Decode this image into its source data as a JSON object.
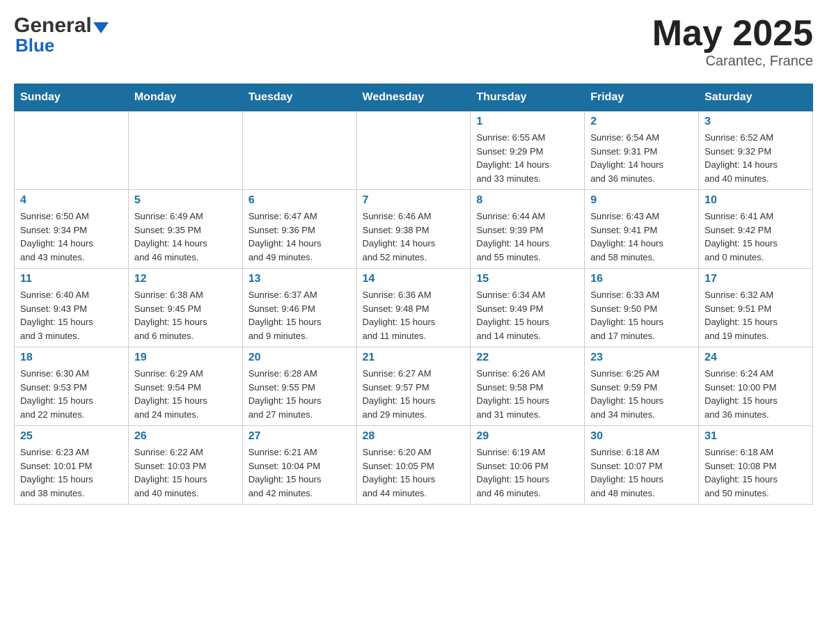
{
  "header": {
    "logo_line1": "General",
    "logo_line2": "Blue",
    "month_year": "May 2025",
    "location": "Carantec, France"
  },
  "days_of_week": [
    "Sunday",
    "Monday",
    "Tuesday",
    "Wednesday",
    "Thursday",
    "Friday",
    "Saturday"
  ],
  "weeks": [
    [
      {
        "day": "",
        "info": ""
      },
      {
        "day": "",
        "info": ""
      },
      {
        "day": "",
        "info": ""
      },
      {
        "day": "",
        "info": ""
      },
      {
        "day": "1",
        "info": "Sunrise: 6:55 AM\nSunset: 9:29 PM\nDaylight: 14 hours\nand 33 minutes."
      },
      {
        "day": "2",
        "info": "Sunrise: 6:54 AM\nSunset: 9:31 PM\nDaylight: 14 hours\nand 36 minutes."
      },
      {
        "day": "3",
        "info": "Sunrise: 6:52 AM\nSunset: 9:32 PM\nDaylight: 14 hours\nand 40 minutes."
      }
    ],
    [
      {
        "day": "4",
        "info": "Sunrise: 6:50 AM\nSunset: 9:34 PM\nDaylight: 14 hours\nand 43 minutes."
      },
      {
        "day": "5",
        "info": "Sunrise: 6:49 AM\nSunset: 9:35 PM\nDaylight: 14 hours\nand 46 minutes."
      },
      {
        "day": "6",
        "info": "Sunrise: 6:47 AM\nSunset: 9:36 PM\nDaylight: 14 hours\nand 49 minutes."
      },
      {
        "day": "7",
        "info": "Sunrise: 6:46 AM\nSunset: 9:38 PM\nDaylight: 14 hours\nand 52 minutes."
      },
      {
        "day": "8",
        "info": "Sunrise: 6:44 AM\nSunset: 9:39 PM\nDaylight: 14 hours\nand 55 minutes."
      },
      {
        "day": "9",
        "info": "Sunrise: 6:43 AM\nSunset: 9:41 PM\nDaylight: 14 hours\nand 58 minutes."
      },
      {
        "day": "10",
        "info": "Sunrise: 6:41 AM\nSunset: 9:42 PM\nDaylight: 15 hours\nand 0 minutes."
      }
    ],
    [
      {
        "day": "11",
        "info": "Sunrise: 6:40 AM\nSunset: 9:43 PM\nDaylight: 15 hours\nand 3 minutes."
      },
      {
        "day": "12",
        "info": "Sunrise: 6:38 AM\nSunset: 9:45 PM\nDaylight: 15 hours\nand 6 minutes."
      },
      {
        "day": "13",
        "info": "Sunrise: 6:37 AM\nSunset: 9:46 PM\nDaylight: 15 hours\nand 9 minutes."
      },
      {
        "day": "14",
        "info": "Sunrise: 6:36 AM\nSunset: 9:48 PM\nDaylight: 15 hours\nand 11 minutes."
      },
      {
        "day": "15",
        "info": "Sunrise: 6:34 AM\nSunset: 9:49 PM\nDaylight: 15 hours\nand 14 minutes."
      },
      {
        "day": "16",
        "info": "Sunrise: 6:33 AM\nSunset: 9:50 PM\nDaylight: 15 hours\nand 17 minutes."
      },
      {
        "day": "17",
        "info": "Sunrise: 6:32 AM\nSunset: 9:51 PM\nDaylight: 15 hours\nand 19 minutes."
      }
    ],
    [
      {
        "day": "18",
        "info": "Sunrise: 6:30 AM\nSunset: 9:53 PM\nDaylight: 15 hours\nand 22 minutes."
      },
      {
        "day": "19",
        "info": "Sunrise: 6:29 AM\nSunset: 9:54 PM\nDaylight: 15 hours\nand 24 minutes."
      },
      {
        "day": "20",
        "info": "Sunrise: 6:28 AM\nSunset: 9:55 PM\nDaylight: 15 hours\nand 27 minutes."
      },
      {
        "day": "21",
        "info": "Sunrise: 6:27 AM\nSunset: 9:57 PM\nDaylight: 15 hours\nand 29 minutes."
      },
      {
        "day": "22",
        "info": "Sunrise: 6:26 AM\nSunset: 9:58 PM\nDaylight: 15 hours\nand 31 minutes."
      },
      {
        "day": "23",
        "info": "Sunrise: 6:25 AM\nSunset: 9:59 PM\nDaylight: 15 hours\nand 34 minutes."
      },
      {
        "day": "24",
        "info": "Sunrise: 6:24 AM\nSunset: 10:00 PM\nDaylight: 15 hours\nand 36 minutes."
      }
    ],
    [
      {
        "day": "25",
        "info": "Sunrise: 6:23 AM\nSunset: 10:01 PM\nDaylight: 15 hours\nand 38 minutes."
      },
      {
        "day": "26",
        "info": "Sunrise: 6:22 AM\nSunset: 10:03 PM\nDaylight: 15 hours\nand 40 minutes."
      },
      {
        "day": "27",
        "info": "Sunrise: 6:21 AM\nSunset: 10:04 PM\nDaylight: 15 hours\nand 42 minutes."
      },
      {
        "day": "28",
        "info": "Sunrise: 6:20 AM\nSunset: 10:05 PM\nDaylight: 15 hours\nand 44 minutes."
      },
      {
        "day": "29",
        "info": "Sunrise: 6:19 AM\nSunset: 10:06 PM\nDaylight: 15 hours\nand 46 minutes."
      },
      {
        "day": "30",
        "info": "Sunrise: 6:18 AM\nSunset: 10:07 PM\nDaylight: 15 hours\nand 48 minutes."
      },
      {
        "day": "31",
        "info": "Sunrise: 6:18 AM\nSunset: 10:08 PM\nDaylight: 15 hours\nand 50 minutes."
      }
    ]
  ]
}
